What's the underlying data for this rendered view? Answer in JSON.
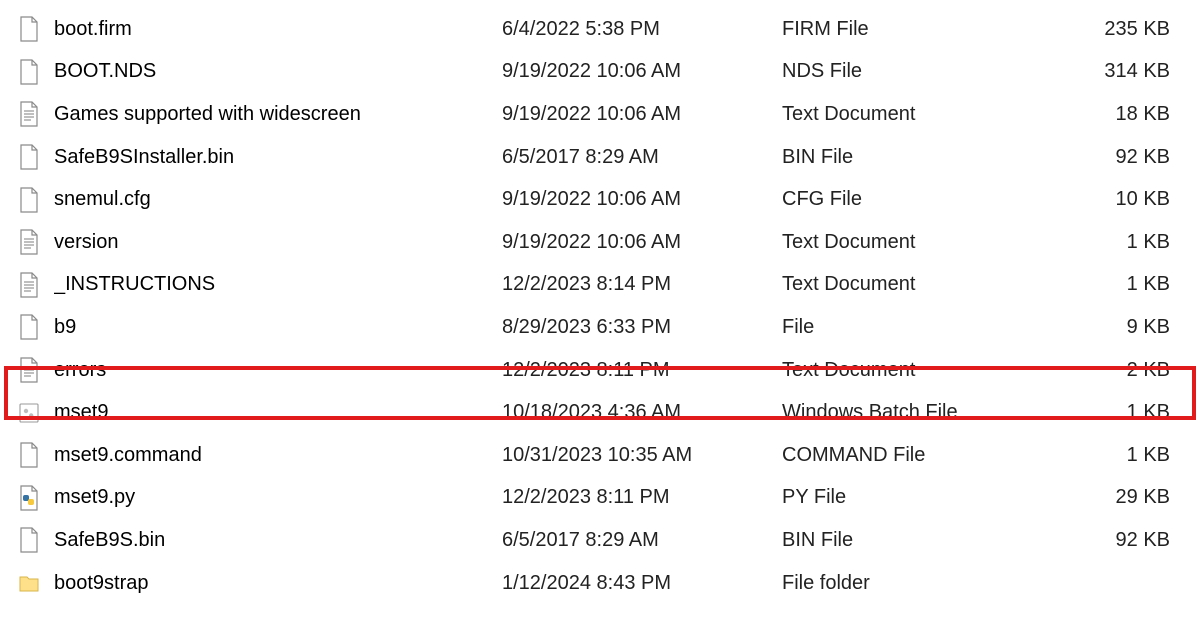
{
  "files": [
    {
      "icon": "file-blank",
      "name": "boot.firm",
      "date": "6/4/2022 5:38 PM",
      "type": "FIRM File",
      "size": "235 KB"
    },
    {
      "icon": "file-blank",
      "name": "BOOT.NDS",
      "date": "9/19/2022 10:06 AM",
      "type": "NDS File",
      "size": "314 KB"
    },
    {
      "icon": "file-text",
      "name": "Games supported with widescreen",
      "date": "9/19/2022 10:06 AM",
      "type": "Text Document",
      "size": "18 KB"
    },
    {
      "icon": "file-blank",
      "name": "SafeB9SInstaller.bin",
      "date": "6/5/2017 8:29 AM",
      "type": "BIN File",
      "size": "92 KB"
    },
    {
      "icon": "file-blank",
      "name": "snemul.cfg",
      "date": "9/19/2022 10:06 AM",
      "type": "CFG File",
      "size": "10 KB"
    },
    {
      "icon": "file-text",
      "name": "version",
      "date": "9/19/2022 10:06 AM",
      "type": "Text Document",
      "size": "1 KB"
    },
    {
      "icon": "file-text",
      "name": "_INSTRUCTIONS",
      "date": "12/2/2023 8:14 PM",
      "type": "Text Document",
      "size": "1 KB"
    },
    {
      "icon": "file-blank",
      "name": "b9",
      "date": "8/29/2023 6:33 PM",
      "type": "File",
      "size": "9 KB"
    },
    {
      "icon": "file-text",
      "name": "errors",
      "date": "12/2/2023 8:11 PM",
      "type": "Text Document",
      "size": "2 KB"
    },
    {
      "icon": "file-batch",
      "name": "mset9",
      "date": "10/18/2023 4:36 AM",
      "type": "Windows Batch File",
      "size": "1 KB",
      "highlighted": true
    },
    {
      "icon": "file-blank",
      "name": "mset9.command",
      "date": "10/31/2023 10:35 AM",
      "type": "COMMAND File",
      "size": "1 KB"
    },
    {
      "icon": "file-python",
      "name": "mset9.py",
      "date": "12/2/2023 8:11 PM",
      "type": "PY File",
      "size": "29 KB"
    },
    {
      "icon": "file-blank",
      "name": "SafeB9S.bin",
      "date": "6/5/2017 8:29 AM",
      "type": "BIN File",
      "size": "92 KB"
    },
    {
      "icon": "folder",
      "name": "boot9strap",
      "date": "1/12/2024 8:43 PM",
      "type": "File folder",
      "size": ""
    }
  ],
  "highlight_color": "#e11b1b"
}
